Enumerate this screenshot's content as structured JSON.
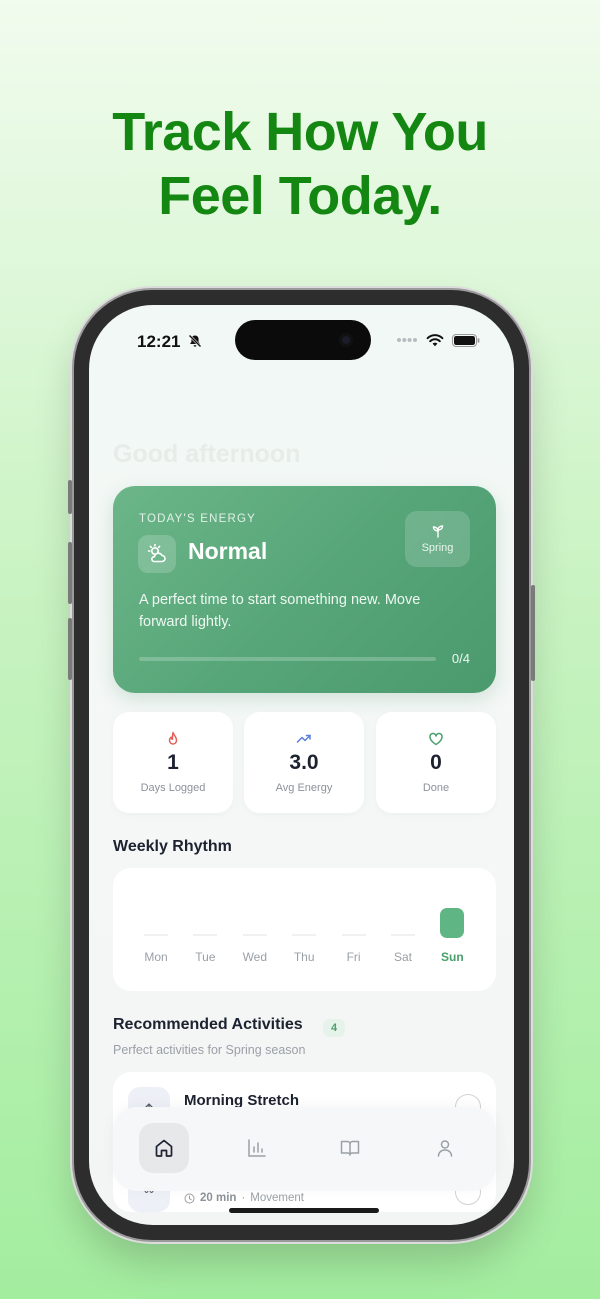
{
  "headline": {
    "line1": "Track How You",
    "line2": "Feel Today."
  },
  "status_bar": {
    "time": "12:21"
  },
  "greeting": "Good afternoon",
  "energy_card": {
    "label": "TODAY'S ENERGY",
    "level": "Normal",
    "season": "Spring",
    "description": "A perfect time to start something new. Move forward lightly.",
    "progress": {
      "completed": 0,
      "total": 4,
      "text": "0/4"
    }
  },
  "stats": [
    {
      "icon": "flame-icon",
      "value": "1",
      "label": "Days Logged",
      "color": "#e0605a"
    },
    {
      "icon": "trend-up-icon",
      "value": "3.0",
      "label": "Avg Energy",
      "color": "#5b7fe0"
    },
    {
      "icon": "heart-icon",
      "value": "0",
      "label": "Done",
      "color": "#4a9f6c"
    }
  ],
  "weekly": {
    "title": "Weekly Rhythm",
    "days": [
      {
        "label": "Mon",
        "value": 0
      },
      {
        "label": "Tue",
        "value": 0
      },
      {
        "label": "Wed",
        "value": 0
      },
      {
        "label": "Thu",
        "value": 0
      },
      {
        "label": "Fri",
        "value": 0
      },
      {
        "label": "Sat",
        "value": 0
      },
      {
        "label": "Sun",
        "value": 3.0,
        "active": true
      }
    ],
    "bar_color": "#5fb584"
  },
  "recommended": {
    "title": "Recommended Activities",
    "count": "4",
    "subtitle": "Perfect activities for Spring season",
    "items": [
      {
        "title": "Morning Stretch"
      },
      {
        "duration": "20 min",
        "category": "Movement"
      }
    ]
  },
  "tabbar": {
    "tabs": [
      "home-icon",
      "chart-icon",
      "book-icon",
      "profile-icon"
    ],
    "active": 0
  },
  "colors": {
    "accent": "#138712",
    "card_green": "#57a679"
  }
}
